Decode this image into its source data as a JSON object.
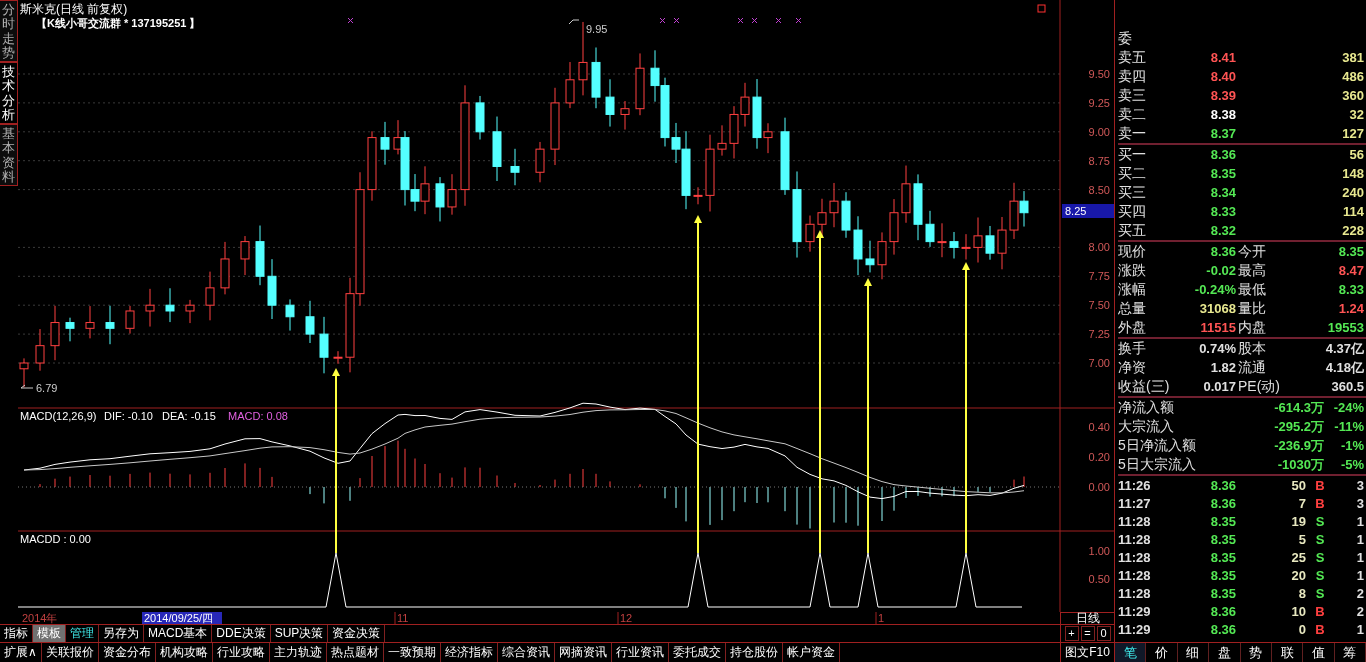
{
  "side_tabs": [
    {
      "label": "分时走势",
      "selected": false
    },
    {
      "label": "技术分析",
      "selected": true
    },
    {
      "label": "基本资料",
      "selected": false
    }
  ],
  "chart": {
    "title": "斯米克(日线 前复权)",
    "note": "【K线小哥交流群 * 137195251 】",
    "high_label": "9.95",
    "low_label": "6.79",
    "price_ticks": [
      "9.50",
      "9.25",
      "9.00",
      "8.75",
      "8.50",
      "8.00",
      "7.75",
      "7.50",
      "7.25",
      "7.00"
    ],
    "current_price": "8.25",
    "macd": {
      "name": "MACD(12,26,9)",
      "dif": "DIF: -0.10",
      "dea": "DEA: -0.15",
      "value": "MACD: 0.08",
      "ticks": [
        "0.40",
        "0.20",
        "0.00"
      ]
    },
    "macdd": {
      "name": "MACDD : 0.00",
      "ticks": [
        "1.00",
        "0.50"
      ]
    }
  },
  "date_axis": [
    {
      "label": "2014年",
      "kind": "year"
    },
    {
      "label": "2014/09/25/四",
      "kind": "cursor"
    },
    {
      "label": "11",
      "kind": "month"
    },
    {
      "label": "12",
      "kind": "month"
    },
    {
      "label": "1",
      "kind": "month"
    }
  ],
  "period": "日线",
  "zoom_buttons": [
    "+",
    "=",
    "0"
  ],
  "indicator_tabs": [
    {
      "label": "指标",
      "selected": false,
      "highlighted": false
    },
    {
      "label": "模板",
      "selected": true,
      "highlighted": false
    },
    {
      "label": "管理",
      "selected": false,
      "highlighted": true
    },
    {
      "label": "另存为",
      "selected": false,
      "highlighted": false
    },
    {
      "label": "MACD基本",
      "selected": false,
      "highlighted": false
    },
    {
      "label": "DDE决策",
      "selected": false,
      "highlighted": false
    },
    {
      "label": "SUP决策",
      "selected": false,
      "highlighted": false
    },
    {
      "label": "资金决策",
      "selected": false,
      "highlighted": false
    }
  ],
  "function_bar": [
    "扩展∧",
    "关联报价",
    "资金分布",
    "机构攻略",
    "行业攻略",
    "主力轨迹",
    "热点题材",
    "一致预期",
    "经济指标",
    "综合资讯",
    "网摘资讯",
    "行业资讯",
    "委托成交",
    "持仓股份",
    "帐户资金"
  ],
  "f10_button": "图文F10",
  "quote": {
    "book_header": "委",
    "asks": [
      {
        "label": "卖五",
        "price": "8.41",
        "volume": "381",
        "color": "#ff5454"
      },
      {
        "label": "卖四",
        "price": "8.40",
        "volume": "486",
        "color": "#ff5454"
      },
      {
        "label": "卖三",
        "price": "8.39",
        "volume": "360",
        "color": "#ff5454"
      },
      {
        "label": "卖二",
        "price": "8.38",
        "volume": "32",
        "color": "#ffffff"
      },
      {
        "label": "卖一",
        "price": "8.37",
        "volume": "127",
        "color": "#54e854"
      }
    ],
    "bids": [
      {
        "label": "买一",
        "price": "8.36",
        "volume": "56",
        "color": "#54e854"
      },
      {
        "label": "买二",
        "price": "8.35",
        "volume": "148",
        "color": "#54e854"
      },
      {
        "label": "买三",
        "price": "8.34",
        "volume": "240",
        "color": "#54e854"
      },
      {
        "label": "买四",
        "price": "8.33",
        "volume": "114",
        "color": "#54e854"
      },
      {
        "label": "买五",
        "price": "8.32",
        "volume": "228",
        "color": "#54e854"
      }
    ],
    "stats": [
      {
        "cells": [
          {
            "label": "现价",
            "value": "8.36",
            "color": "#54e854"
          },
          {
            "label": "今开",
            "value": "8.35",
            "color": "#54e854"
          }
        ]
      },
      {
        "cells": [
          {
            "label": "涨跌",
            "value": "-0.02",
            "color": "#54e854"
          },
          {
            "label": "最高",
            "value": "8.47",
            "color": "#ff5454"
          }
        ]
      },
      {
        "cells": [
          {
            "label": "涨幅",
            "value": "-0.24%",
            "color": "#54e854"
          },
          {
            "label": "最低",
            "value": "8.33",
            "color": "#54e854"
          }
        ]
      },
      {
        "cells": [
          {
            "label": "总量",
            "value": "31068",
            "color": "#e8e890"
          },
          {
            "label": "量比",
            "value": "1.24",
            "color": "#ff5454"
          }
        ]
      },
      {
        "cells": [
          {
            "label": "外盘",
            "value": "11515",
            "color": "#ff5454"
          },
          {
            "label": "内盘",
            "value": "19553",
            "color": "#54e854"
          }
        ]
      }
    ],
    "fundamentals": [
      {
        "label": "换手",
        "value": "0.74%",
        "label2": "股本",
        "value2": "4.37亿"
      },
      {
        "label": "净资",
        "value": "1.82",
        "label2": "流通",
        "value2": "4.18亿"
      },
      {
        "label": "收益(三)",
        "value": "0.017",
        "label2": "PE(动)",
        "value2": "360.5"
      }
    ],
    "flows": [
      {
        "label": "净流入额",
        "amount": "-614.3万",
        "ratio": "-24%"
      },
      {
        "label": "大宗流入",
        "amount": "-295.2万",
        "ratio": "-11%"
      },
      {
        "label": "5日净流入额",
        "amount": "-236.9万",
        "ratio": "-1%"
      },
      {
        "label": "5日大宗流入",
        "amount": "-1030万",
        "ratio": "-5%"
      }
    ],
    "trades": [
      {
        "time": "11:26",
        "price": "8.36",
        "volume": "50",
        "side": "B",
        "color": "#ff4040",
        "count": "3"
      },
      {
        "time": "11:27",
        "price": "8.36",
        "volume": "7",
        "side": "B",
        "color": "#ff4040",
        "count": "3"
      },
      {
        "time": "11:28",
        "price": "8.35",
        "volume": "19",
        "side": "S",
        "color": "#54e854",
        "count": "1"
      },
      {
        "time": "11:28",
        "price": "8.35",
        "volume": "5",
        "side": "S",
        "color": "#54e854",
        "count": "1"
      },
      {
        "time": "11:28",
        "price": "8.35",
        "volume": "25",
        "side": "S",
        "color": "#54e854",
        "count": "1"
      },
      {
        "time": "11:28",
        "price": "8.35",
        "volume": "20",
        "side": "S",
        "color": "#54e854",
        "count": "1"
      },
      {
        "time": "11:28",
        "price": "8.35",
        "volume": "8",
        "side": "S",
        "color": "#54e854",
        "count": "2"
      },
      {
        "time": "11:29",
        "price": "8.36",
        "volume": "10",
        "side": "B",
        "color": "#ff4040",
        "count": "2"
      },
      {
        "time": "11:29",
        "price": "8.36",
        "volume": "0",
        "side": "B",
        "color": "#ff4040",
        "count": "1"
      }
    ]
  },
  "detail_tabs": [
    {
      "label": "笔",
      "selected": true
    },
    {
      "label": "价",
      "selected": false
    },
    {
      "label": "细",
      "selected": false
    },
    {
      "label": "盘",
      "selected": false
    },
    {
      "label": "势",
      "selected": false
    },
    {
      "label": "联",
      "selected": false
    },
    {
      "label": "值",
      "selected": false
    },
    {
      "label": "筹",
      "selected": false
    }
  ]
}
